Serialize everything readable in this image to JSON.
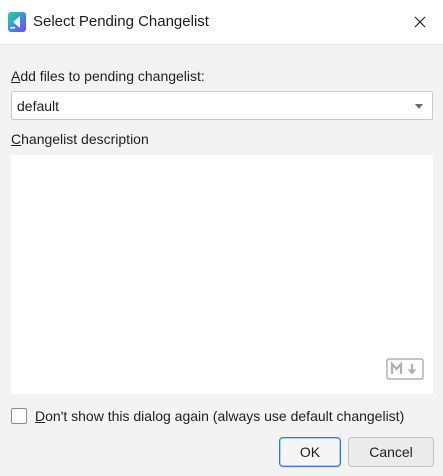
{
  "window": {
    "title": "Select Pending Changelist",
    "close_icon": "close-icon",
    "app_icon": "jetbrains-app-icon"
  },
  "form": {
    "add_label_mnemonic": "A",
    "add_label_rest": "dd files to pending changelist:",
    "changelist_value": "default",
    "description_label_mnemonic": "C",
    "description_label_rest": "hangelist description",
    "description_value": "",
    "markdown_icon": "markdown-icon"
  },
  "checkbox": {
    "label_mnemonic": "D",
    "label_rest": "on't show this dialog again (always use default changelist)",
    "checked": false
  },
  "buttons": {
    "ok_label": "OK",
    "cancel_label": "Cancel"
  },
  "colors": {
    "accent": "#3574f0",
    "background": "#f3f3f3",
    "field": "#ffffff"
  }
}
